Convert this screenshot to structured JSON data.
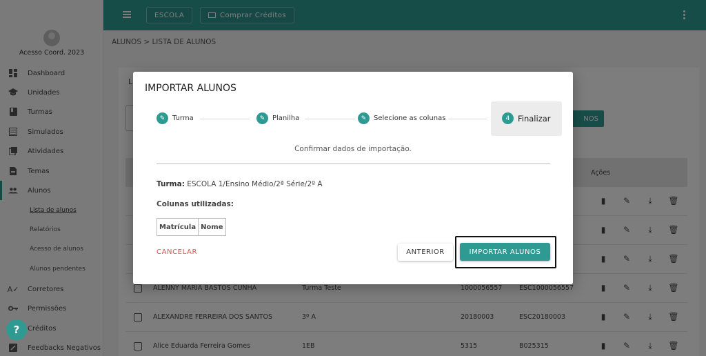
{
  "sidebar": {
    "profile_name": "Acesso Coord. 2023",
    "items": [
      {
        "label": "Dashboard",
        "icon": "dashboard-icon"
      },
      {
        "label": "Unidades",
        "icon": "school-icon"
      },
      {
        "label": "Turmas",
        "icon": "book-icon"
      },
      {
        "label": "Simulados",
        "icon": "list-icon"
      },
      {
        "label": "Atividades",
        "icon": "library-icon"
      },
      {
        "label": "Temas",
        "icon": "document-icon"
      },
      {
        "label": "Alunos",
        "icon": "people-icon"
      },
      {
        "label": "Corretores",
        "icon": "spellcheck-icon"
      },
      {
        "label": "Permissões",
        "icon": "key-icon"
      },
      {
        "label": "Créditos",
        "icon": "credits-icon"
      },
      {
        "label": "Feedbacks Negativos",
        "icon": "feedback-icon"
      }
    ],
    "sub_items": [
      "Lista de alunos",
      "Relatórios",
      "Acesso de alunos",
      "Alunos pendentes"
    ]
  },
  "topbar": {
    "escola_label": "ESCOLA",
    "comprar_label": "Comprar Créditos"
  },
  "breadcrumb": "ALUNOS > LISTA DE ALUNOS",
  "background": {
    "card_title_fragment": "L",
    "button_fragment": "NOS",
    "acoes_header": "Ações",
    "rows": [
      {
        "name": "ALENNY MARIA BASTOS CUNHA",
        "turma": "Turma Teste",
        "matricula": "1000056557",
        "codigo": "ESC1000056557"
      },
      {
        "name": "ALEXANDRE FERREIRA DOS SANTOS",
        "turma": "3º A",
        "matricula": "20180003",
        "codigo": "ESC20180003"
      },
      {
        "name": "Alice Eduarda Ferreira Gomes",
        "turma": "1EB",
        "matricula": "5315",
        "codigo": "B025315"
      }
    ]
  },
  "dialog": {
    "title": "IMPORTAR ALUNOS",
    "steps": [
      {
        "label": "Turma",
        "marker": "✎"
      },
      {
        "label": "Planilha",
        "marker": "✎"
      },
      {
        "label": "Selecione as colunas",
        "marker": "✎"
      },
      {
        "label": "Finalizar",
        "marker": "4"
      }
    ],
    "confirm_text": "Confirmar dados de importação.",
    "turma_label": "Turma:",
    "turma_value": "ESCOLA 1/Ensino Médio/2ª Série/2º A",
    "columns_label": "Colunas utilizadas:",
    "columns": [
      "Matrícula",
      "Nome"
    ],
    "cancel_label": "CANCELAR",
    "prev_label": "ANTERIOR",
    "import_label": "IMPORTAR ALUNOS"
  },
  "colors": {
    "accent": "#2e9a91",
    "cancel": "#d9534f"
  }
}
